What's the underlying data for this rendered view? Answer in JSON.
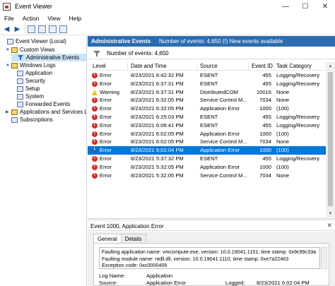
{
  "window": {
    "title": "Event Viewer",
    "minimize": "—",
    "maximize": "☐",
    "close": "✕"
  },
  "menu": [
    "File",
    "Action",
    "View",
    "Help"
  ],
  "tree": {
    "root": "Event Viewer (Local)",
    "custom_views": "Custom Views",
    "admin_events": "Administrative Events",
    "windows_logs": "Windows Logs",
    "application": "Application",
    "security": "Security",
    "setup": "Setup",
    "system": "System",
    "forwarded": "Forwarded Events",
    "apps_services": "Applications and Services Lo",
    "subscriptions": "Subscriptions"
  },
  "pane": {
    "title": "Administrative Events",
    "summary": "Number of events: 4,650 (!) New events available",
    "count": "Number of events: 4,650"
  },
  "grid": {
    "headers": {
      "level": "Level",
      "datetime": "Date and Time",
      "source": "Source",
      "event_id": "Event ID",
      "category": "Task Category"
    },
    "rows": [
      {
        "icon": "err",
        "level": "Error",
        "datetime": "8/23/2021 6:42:32 PM",
        "source": "ESENT",
        "id": "455",
        "cat": "Logging/Recovery"
      },
      {
        "icon": "err",
        "level": "Error",
        "datetime": "8/23/2021 6:37:31 PM",
        "source": "ESENT",
        "id": "455",
        "cat": "Logging/Recovery"
      },
      {
        "icon": "warn",
        "level": "Warning",
        "datetime": "8/23/2021 6:37:31 PM",
        "source": "DistributedCOM",
        "id": "10016",
        "cat": "None"
      },
      {
        "icon": "err",
        "level": "Error",
        "datetime": "8/23/2021 6:32:05 PM",
        "source": "Service Control M...",
        "id": "7034",
        "cat": "None"
      },
      {
        "icon": "err",
        "level": "Error",
        "datetime": "8/23/2021 6:32:05 PM",
        "source": "Application Error",
        "id": "1000",
        "cat": "(100)"
      },
      {
        "icon": "err",
        "level": "Error",
        "datetime": "8/23/2021 6:25:03 PM",
        "source": "ESENT",
        "id": "455",
        "cat": "Logging/Recovery"
      },
      {
        "icon": "err",
        "level": "Error",
        "datetime": "8/23/2021 6:06:41 PM",
        "source": "ESENT",
        "id": "455",
        "cat": "Logging/Recovery"
      },
      {
        "icon": "err",
        "level": "Error",
        "datetime": "8/23/2021 6:02:05 PM",
        "source": "Application Error",
        "id": "1000",
        "cat": "(100)"
      },
      {
        "icon": "err",
        "level": "Error",
        "datetime": "8/23/2021 6:02:05 PM",
        "source": "Service Control M...",
        "id": "7034",
        "cat": "None"
      },
      {
        "icon": "info",
        "level": "Error",
        "datetime": "8/23/2021 6:02:04 PM",
        "source": "Application Error",
        "id": "1000",
        "cat": "(100)"
      },
      {
        "icon": "err",
        "level": "Error",
        "datetime": "8/23/2021 5:37:32 PM",
        "source": "ESENT",
        "id": "455",
        "cat": "Logging/Recovery"
      },
      {
        "icon": "err",
        "level": "Error",
        "datetime": "8/23/2021 5:32:05 PM",
        "source": "Application Error",
        "id": "1000",
        "cat": "(100)"
      },
      {
        "icon": "err",
        "level": "Error",
        "datetime": "8/23/2021 5:32:05 PM",
        "source": "Service Control M...",
        "id": "7034",
        "cat": "None"
      }
    ],
    "selected_index": 9
  },
  "detail": {
    "title": "Event 1000, Application Error",
    "close": "✕",
    "tabs": [
      "General",
      "Details"
    ],
    "message_lines": [
      "Faulting application name: vmcompute.exe, version: 10.0.19041.1151, time stamp: 0x9c99c33a",
      "Faulting module name: ntdll.dll, version: 10.0.19041.1110, time stamp: 0xe7a22463",
      "Exception code: 0xc0000409"
    ],
    "log_name_label": "Log Name:",
    "log_name_value": "Application",
    "source_label": "Source:",
    "source_value": "Application Error",
    "logged_label": "Logged:",
    "logged_value": "8/23/2021 6:02:04 PM"
  },
  "colors": {
    "header_blue": "#2b6cb0",
    "selection": "#0078d7",
    "error_red": "#d92b2b",
    "warning_yellow": "#f2c811"
  }
}
